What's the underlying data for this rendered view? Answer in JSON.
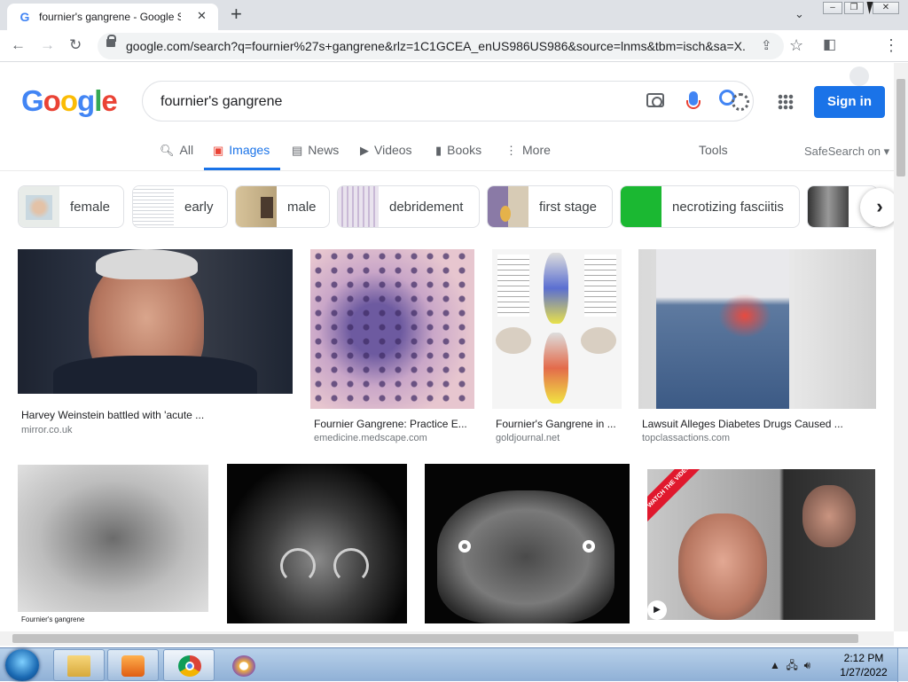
{
  "browser": {
    "tab_title": "fournier's gangrene - Google Sea",
    "tab_close": "✕",
    "new_tab": "+",
    "url": "google.com/search?q=fournier%27s+gangrene&rlz=1C1GCEA_enUS986US986&source=lnms&tbm=isch&sa=X...",
    "back": "←",
    "forward": "→",
    "reload": "↻"
  },
  "google": {
    "logo": "Google",
    "query": "fournier's gangrene",
    "signin_label": "Sign in",
    "tabs": [
      {
        "label": "All",
        "icon": "search-icon"
      },
      {
        "label": "Images",
        "icon": "image-icon"
      },
      {
        "label": "News",
        "icon": "news-icon"
      },
      {
        "label": "Videos",
        "icon": "video-icon"
      },
      {
        "label": "Books",
        "icon": "book-icon"
      },
      {
        "label": "More",
        "icon": "more-vert-icon"
      }
    ],
    "tools_label": "Tools",
    "safesearch_label": "SafeSearch on ▾",
    "chips": [
      "female",
      "early",
      "male",
      "debridement",
      "first stage",
      "necrotizing fasciitis"
    ],
    "results": [
      {
        "caption": "Harvey Weinstein battled with 'acute ...",
        "source": "mirror.co.uk"
      },
      {
        "caption": "Fournier Gangrene: Practice E...",
        "source": "emedicine.medscape.com"
      },
      {
        "caption": "Fournier's Gangrene in ...",
        "source": "goldjournal.net"
      },
      {
        "caption": "Lawsuit Alleges Diabetes Drugs Caused ...",
        "source": "topclassactions.com"
      }
    ],
    "partial_caption": "Fournier's gangrene",
    "watch_badge": "WATCH THE VIDEO"
  },
  "taskbar": {
    "time": "2:12 PM",
    "date": "1/27/2022"
  },
  "colors": {
    "accent": "#1a73e8",
    "tab_strip": "#dee1e6",
    "taskbar": "#9fbfe0"
  }
}
